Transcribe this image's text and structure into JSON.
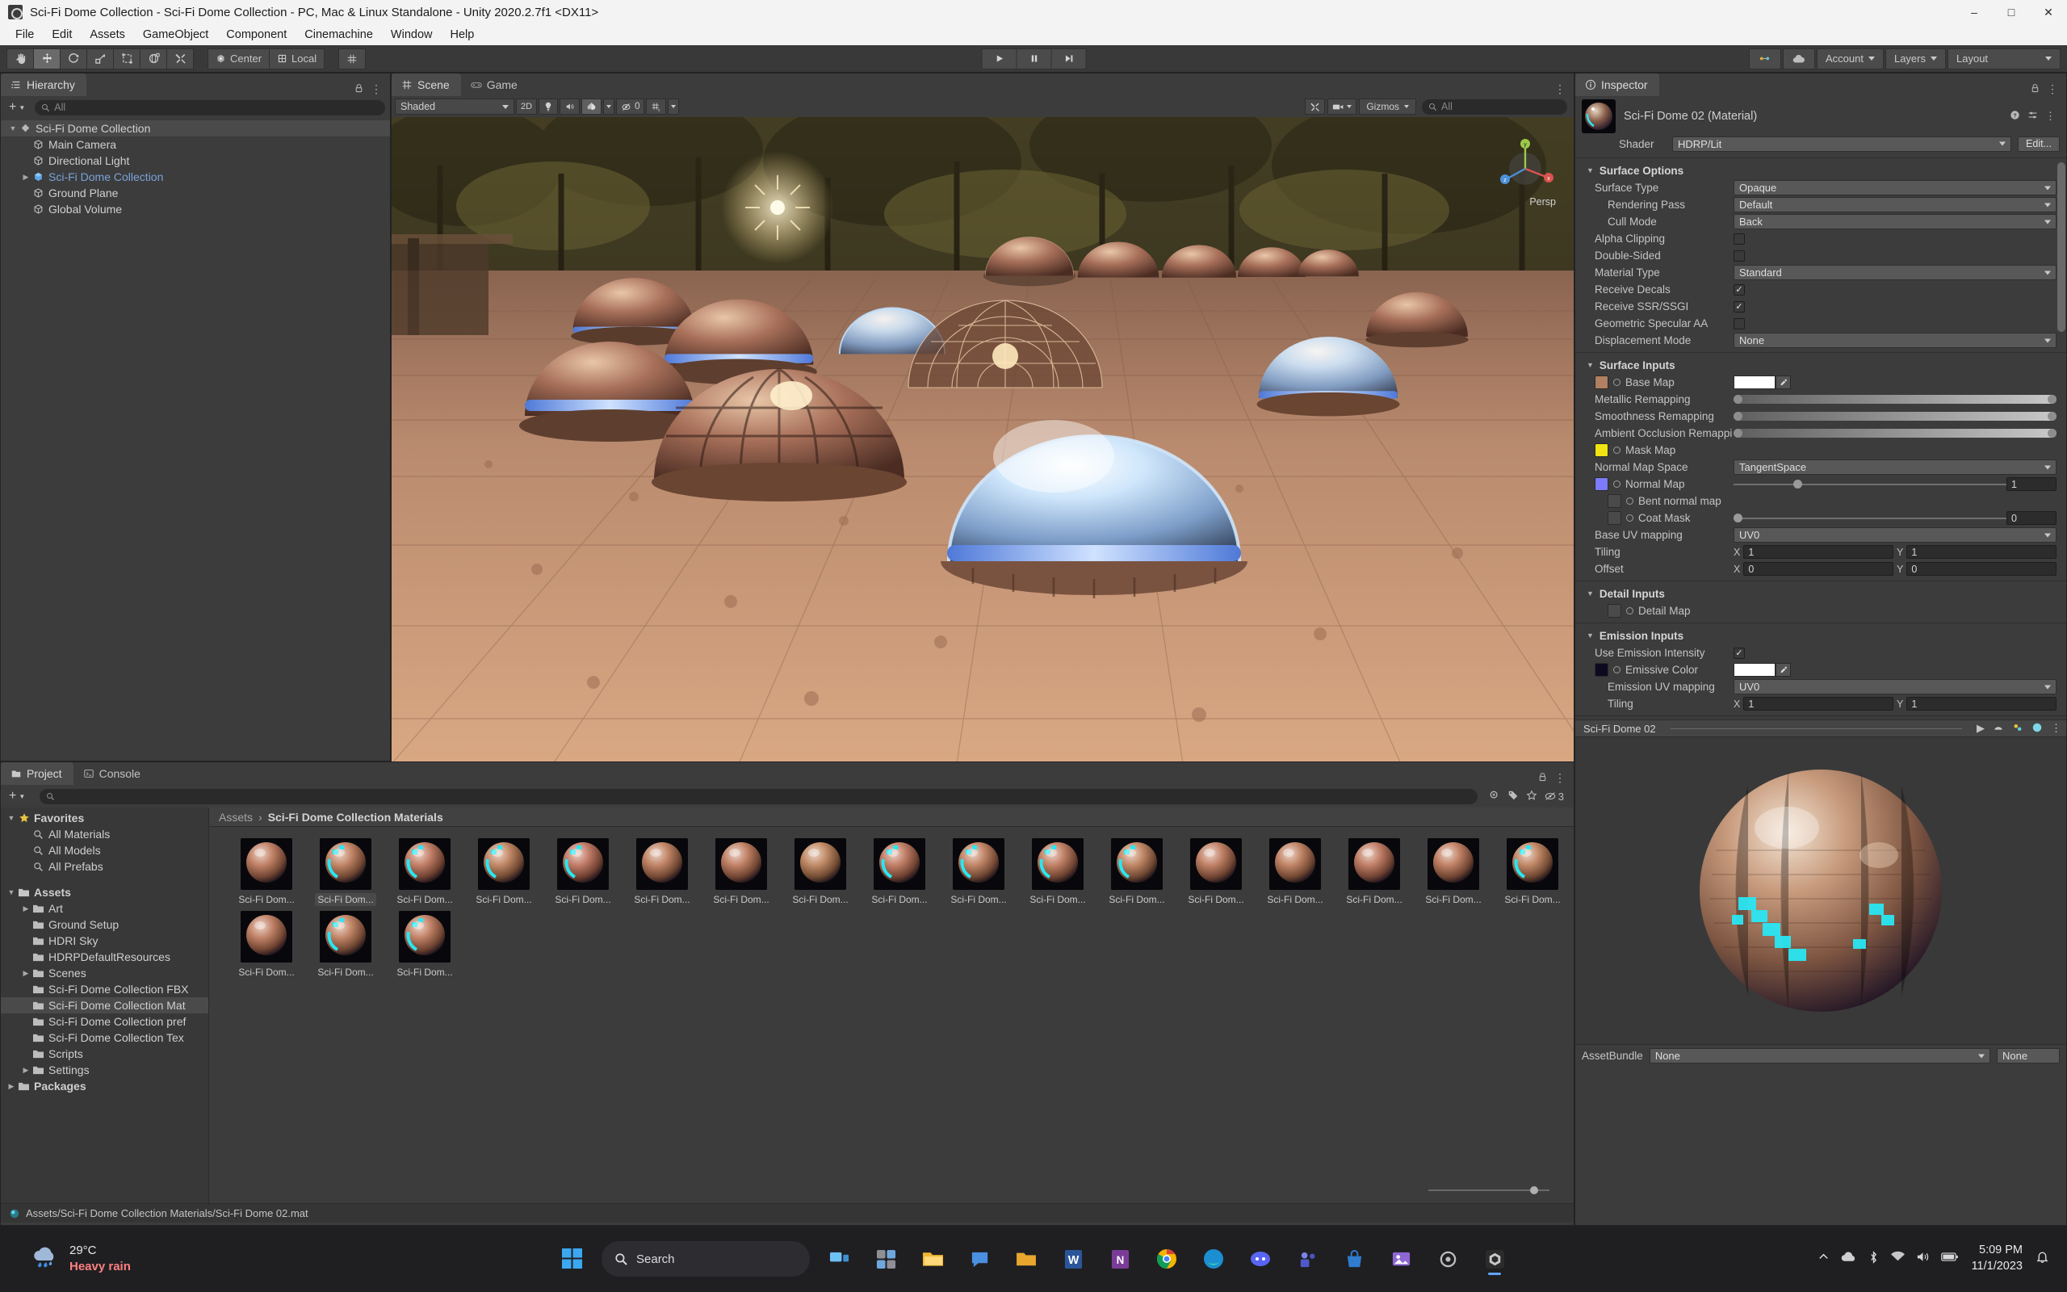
{
  "window": {
    "title": "Sci-Fi Dome Collection - Sci-Fi Dome Collection - PC, Mac & Linux Standalone - Unity 2020.2.7f1 <DX11>",
    "minimize": "–",
    "maximize": "□",
    "close": "✕"
  },
  "menubar": {
    "items": [
      "File",
      "Edit",
      "Assets",
      "GameObject",
      "Component",
      "Cinemachine",
      "Window",
      "Help"
    ]
  },
  "toolbar": {
    "tools": [
      "hand-tool",
      "move-tool",
      "rotate-tool",
      "scale-tool",
      "rect-tool",
      "transform-tool",
      "custom-tool"
    ],
    "pivot_label": "Center",
    "space_label": "Local",
    "play": "▶",
    "pause": "❙❙",
    "step": "▶❙",
    "account_label": "Account",
    "layers_label": "Layers",
    "layout_label": "Layout"
  },
  "hierarchy": {
    "tab_label": "Hierarchy",
    "search_placeholder": "All",
    "items": [
      {
        "label": "Sci-Fi Dome Collection",
        "depth": 0,
        "arrow": "down",
        "icon": "scene-icon",
        "selected": true,
        "color": "normal"
      },
      {
        "label": "Main Camera",
        "depth": 1,
        "arrow": "none",
        "icon": "gameobject-icon",
        "selected": false,
        "color": "normal"
      },
      {
        "label": "Directional Light",
        "depth": 1,
        "arrow": "none",
        "icon": "gameobject-icon",
        "selected": false,
        "color": "normal"
      },
      {
        "label": "Sci-Fi Dome Collection",
        "depth": 1,
        "arrow": "right",
        "icon": "prefab-icon",
        "selected": false,
        "color": "blue"
      },
      {
        "label": "Ground Plane",
        "depth": 1,
        "arrow": "none",
        "icon": "gameobject-icon",
        "selected": false,
        "color": "normal"
      },
      {
        "label": "Global Volume",
        "depth": 1,
        "arrow": "none",
        "icon": "gameobject-icon",
        "selected": false,
        "color": "normal"
      }
    ]
  },
  "scene": {
    "tabs": [
      {
        "label": "Scene",
        "icon": "scene-tab-icon",
        "active": true
      },
      {
        "label": "Game",
        "icon": "game-tab-icon",
        "active": false
      }
    ],
    "draw_mode": "Shaded",
    "twod_label": "2D",
    "lighting_icon": "light-bulb-icon",
    "audio_icon": "audio-icon",
    "fx_icon": "effects-icon",
    "hidden_count": "0",
    "grid_icon": "grid-icon",
    "gizmos_label": "Gizmos",
    "gizmo_search_placeholder": "All",
    "persp_label": "Persp",
    "axis_labels": {
      "y": "y",
      "x": "x",
      "z": "z"
    }
  },
  "project": {
    "tabs": [
      {
        "label": "Project",
        "icon": "project-tab-icon",
        "active": true
      },
      {
        "label": "Console",
        "icon": "console-tab-icon",
        "active": false
      }
    ],
    "search_placeholder": "",
    "badge_count": "3",
    "breadcrumb": {
      "root": "Assets",
      "sep": "›",
      "current": "Sci-Fi Dome Collection Materials"
    },
    "tree": [
      {
        "label": "Favorites",
        "depth": 0,
        "arrow": "down",
        "icon": "star-icon",
        "bold": true
      },
      {
        "label": "All Materials",
        "depth": 1,
        "arrow": "none",
        "icon": "search-icon",
        "bold": false
      },
      {
        "label": "All Models",
        "depth": 1,
        "arrow": "none",
        "icon": "search-icon",
        "bold": false
      },
      {
        "label": "All Prefabs",
        "depth": 1,
        "arrow": "none",
        "icon": "search-icon",
        "bold": false
      },
      {
        "label": "",
        "depth": 0,
        "arrow": "none",
        "icon": "spacer",
        "bold": false
      },
      {
        "label": "Assets",
        "depth": 0,
        "arrow": "down",
        "icon": "folder-open-icon",
        "bold": true
      },
      {
        "label": "Art",
        "depth": 1,
        "arrow": "right",
        "icon": "folder-icon",
        "bold": false
      },
      {
        "label": "Ground Setup",
        "depth": 1,
        "arrow": "none",
        "icon": "folder-icon",
        "bold": false
      },
      {
        "label": "HDRI Sky",
        "depth": 1,
        "arrow": "none",
        "icon": "folder-icon",
        "bold": false
      },
      {
        "label": "HDRPDefaultResources",
        "depth": 1,
        "arrow": "none",
        "icon": "folder-icon",
        "bold": false
      },
      {
        "label": "Scenes",
        "depth": 1,
        "arrow": "right",
        "icon": "folder-icon",
        "bold": false
      },
      {
        "label": "Sci-Fi Dome Collection FBX",
        "depth": 1,
        "arrow": "none",
        "icon": "folder-icon",
        "bold": false
      },
      {
        "label": "Sci-Fi Dome Collection Mat",
        "depth": 1,
        "arrow": "none",
        "icon": "folder-icon",
        "bold": false,
        "selected": true
      },
      {
        "label": "Sci-Fi Dome Collection pref",
        "depth": 1,
        "arrow": "none",
        "icon": "folder-icon",
        "bold": false
      },
      {
        "label": "Sci-Fi Dome Collection Tex",
        "depth": 1,
        "arrow": "none",
        "icon": "folder-icon",
        "bold": false
      },
      {
        "label": "Scripts",
        "depth": 1,
        "arrow": "none",
        "icon": "folder-icon",
        "bold": false
      },
      {
        "label": "Settings",
        "depth": 1,
        "arrow": "right",
        "icon": "folder-icon",
        "bold": false
      },
      {
        "label": "Packages",
        "depth": 0,
        "arrow": "right",
        "icon": "folder-icon",
        "bold": true
      }
    ],
    "assets": [
      {
        "label": "Sci-Fi Dom...",
        "selected": false,
        "hue": 18,
        "cyan": 0
      },
      {
        "label": "Sci-Fi Dom...",
        "selected": true,
        "hue": 20,
        "cyan": 1
      },
      {
        "label": "Sci-Fi Dom...",
        "selected": false,
        "hue": 16,
        "cyan": 1
      },
      {
        "label": "Sci-Fi Dom...",
        "selected": false,
        "hue": 22,
        "cyan": 1
      },
      {
        "label": "Sci-Fi Dom...",
        "selected": false,
        "hue": 14,
        "cyan": 1
      },
      {
        "label": "Sci-Fi Dom...",
        "selected": false,
        "hue": 20,
        "cyan": 0
      },
      {
        "label": "Sci-Fi Dom...",
        "selected": false,
        "hue": 18,
        "cyan": 0
      },
      {
        "label": "Sci-Fi Dom...",
        "selected": false,
        "hue": 24,
        "cyan": 0
      },
      {
        "label": "Sci-Fi Dom...",
        "selected": false,
        "hue": 16,
        "cyan": 1
      },
      {
        "label": "Sci-Fi Dom...",
        "selected": false,
        "hue": 20,
        "cyan": 1
      },
      {
        "label": "Sci-Fi Dom...",
        "selected": false,
        "hue": 18,
        "cyan": 1
      },
      {
        "label": "Sci-Fi Dom...",
        "selected": false,
        "hue": 22,
        "cyan": 1
      },
      {
        "label": "Sci-Fi Dom...",
        "selected": false,
        "hue": 18,
        "cyan": 0
      },
      {
        "label": "Sci-Fi Dom...",
        "selected": false,
        "hue": 20,
        "cyan": 0
      },
      {
        "label": "Sci-Fi Dom...",
        "selected": false,
        "hue": 16,
        "cyan": 0
      },
      {
        "label": "Sci-Fi Dom...",
        "selected": false,
        "hue": 18,
        "cyan": 0
      },
      {
        "label": "Sci-Fi Dom...",
        "selected": false,
        "hue": 22,
        "cyan": 1
      },
      {
        "label": "Sci-Fi Dom...",
        "selected": false,
        "hue": 18,
        "cyan": 0
      },
      {
        "label": "Sci-Fi Dom...",
        "selected": false,
        "hue": 20,
        "cyan": 1
      },
      {
        "label": "Sci-Fi Dom...",
        "selected": false,
        "hue": 18,
        "cyan": 1
      }
    ],
    "status_path": "Assets/Sci-Fi Dome Collection Materials/Sci-Fi Dome 02.mat"
  },
  "inspector": {
    "tab_label": "Inspector",
    "lock_icon": "lock-icon",
    "menu_icon": "kebab-menu-icon",
    "material_name": "Sci-Fi Dome 02 (Material)",
    "shader_label": "Shader",
    "shader_value": "HDRP/Lit",
    "edit_button": "Edit...",
    "sections": [
      {
        "title": "Surface Options",
        "rows": [
          {
            "label": "Surface Type",
            "type": "dropdown",
            "value": "Opaque",
            "indent": 0
          },
          {
            "label": "Rendering Pass",
            "type": "dropdown",
            "value": "Default",
            "indent": 1
          },
          {
            "label": "Cull Mode",
            "type": "dropdown",
            "value": "Back",
            "indent": 1
          },
          {
            "label": "Alpha Clipping",
            "type": "checkbox",
            "value": false,
            "indent": 0
          },
          {
            "label": "Double-Sided",
            "type": "checkbox",
            "value": false,
            "indent": 0
          },
          {
            "label": "Material Type",
            "type": "dropdown",
            "value": "Standard",
            "indent": 0
          },
          {
            "label": "Receive Decals",
            "type": "checkbox",
            "value": true,
            "indent": 0
          },
          {
            "label": "Receive SSR/SSGI",
            "type": "checkbox",
            "value": true,
            "indent": 0
          },
          {
            "label": "Geometric Specular AA",
            "type": "checkbox",
            "value": false,
            "indent": 0
          },
          {
            "label": "Displacement Mode",
            "type": "dropdown",
            "value": "None",
            "indent": 0
          }
        ]
      },
      {
        "title": "Surface Inputs",
        "rows": [
          {
            "label": "Base Map",
            "type": "texture-color",
            "swatch": "#b08060",
            "color": "#ffffff",
            "indent": 0
          },
          {
            "label": "Metallic Remapping",
            "type": "minmax",
            "indent": 0
          },
          {
            "label": "Smoothness Remapping",
            "type": "minmax",
            "indent": 0
          },
          {
            "label": "Ambient Occlusion Remappi",
            "type": "minmax",
            "indent": 0
          },
          {
            "label": "Mask Map",
            "type": "texture-only",
            "swatch": "#f2e313",
            "indent": 0
          },
          {
            "label": "Normal Map Space",
            "type": "dropdown",
            "value": "TangentSpace",
            "indent": 0
          },
          {
            "label": "Normal Map",
            "type": "texture-slider",
            "swatch": "#7b7bfb",
            "value": "1",
            "pos": 0.22,
            "indent": 0
          },
          {
            "label": "Bent normal map",
            "type": "texture-empty",
            "swatch": "#4a4a4a",
            "indent": 1
          },
          {
            "label": "Coat Mask",
            "type": "texture-slider",
            "swatch": "#4a4a4a",
            "value": "0",
            "pos": 0.0,
            "indent": 1
          },
          {
            "label": "Base UV mapping",
            "type": "dropdown",
            "value": "UV0",
            "indent": 0
          },
          {
            "label": "Tiling",
            "type": "xy",
            "x": "1",
            "y": "1",
            "xlab": "X",
            "ylab": "Y",
            "indent": 0
          },
          {
            "label": "Offset",
            "type": "xy",
            "x": "0",
            "y": "0",
            "xlab": "X",
            "ylab": "Y",
            "indent": 0
          }
        ]
      },
      {
        "title": "Detail Inputs",
        "rows": [
          {
            "label": "Detail Map",
            "type": "texture-empty",
            "swatch": "#4a4a4a",
            "indent": 1
          }
        ]
      },
      {
        "title": "Emission Inputs",
        "rows": [
          {
            "label": "Use Emission Intensity",
            "type": "checkbox",
            "value": true,
            "indent": 0
          },
          {
            "label": "Emissive Color",
            "type": "texture-color",
            "swatch": "#0d0a20",
            "color": "#ffffff",
            "indent": 0
          },
          {
            "label": "Emission UV mapping",
            "type": "dropdown",
            "value": "UV0",
            "indent": 1
          },
          {
            "label": "Tiling",
            "type": "xy",
            "x": "1",
            "y": "1",
            "xlab": "X",
            "ylab": "Y",
            "indent": 1
          }
        ]
      }
    ],
    "preview_title": "Sci-Fi Dome 02",
    "preview_icons": [
      "play-icon",
      "sphere-icon",
      "lighting-icon",
      "material-icon",
      "kebab-menu-icon"
    ],
    "assetbundle_label": "AssetBundle",
    "assetbundle_value": "None",
    "assetbundle_variant": "None"
  },
  "taskbar": {
    "weather_temp": "29°C",
    "weather_cond": "Heavy rain",
    "search_label": "Search",
    "time": "5:09 PM",
    "date": "11/1/2023",
    "apps": [
      "start-icon",
      "search-box",
      "task-view-icon",
      "widgets-icon",
      "file-explorer-icon",
      "chat-icon",
      "folder-icon",
      "word-icon",
      "chrome-icon",
      "edge-icon",
      "discord-icon",
      "teams-icon",
      "store-icon",
      "photos-icon",
      "settings-icon",
      "unity-icon"
    ]
  }
}
